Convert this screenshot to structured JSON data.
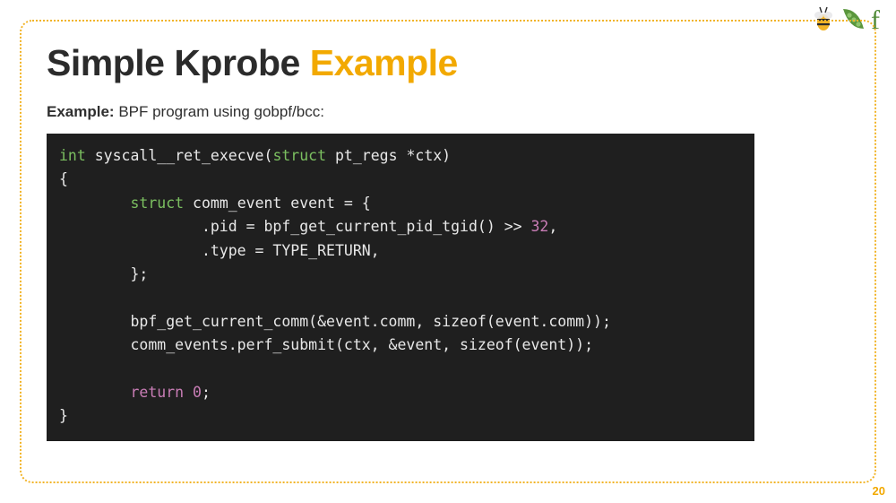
{
  "title": {
    "part1": "Simple Kprobe ",
    "part2": "Example"
  },
  "subtitle": {
    "label": "Example:",
    "text": " BPF program using gobpf/bcc:"
  },
  "code": {
    "tokens": [
      {
        "t": "int",
        "c": "tok-type"
      },
      {
        "t": " syscall__ret_execve("
      },
      {
        "t": "struct",
        "c": "tok-type"
      },
      {
        "t": " pt_regs *ctx)\n{\n        "
      },
      {
        "t": "struct",
        "c": "tok-type"
      },
      {
        "t": " comm_event event = {\n                .pid = bpf_get_current_pid_tgid() >> "
      },
      {
        "t": "32",
        "c": "tok-num"
      },
      {
        "t": ",\n                .type = TYPE_RETURN,\n        };\n\n        bpf_get_current_comm(&event.comm, sizeof(event.comm));\n        comm_events.perf_submit(ctx, &event, sizeof(event));\n\n        "
      },
      {
        "t": "return",
        "c": "tok-kw"
      },
      {
        "t": " "
      },
      {
        "t": "0",
        "c": "tok-num"
      },
      {
        "t": ";\n}"
      }
    ],
    "plain": "int syscall__ret_execve(struct pt_regs *ctx)\n{\n        struct comm_event event = {\n                .pid = bpf_get_current_pid_tgid() >> 32,\n                .type = TYPE_RETURN,\n        };\n\n        bpf_get_current_comm(&event.comm, sizeof(event.comm));\n        comm_events.perf_submit(ctx, &event, sizeof(event));\n\n        return 0;\n}"
  },
  "page_number": "20",
  "logos": {
    "left_name": "bee-icon",
    "middle_name": "pea-pod-icon",
    "right_name": "letter-f-icon"
  }
}
